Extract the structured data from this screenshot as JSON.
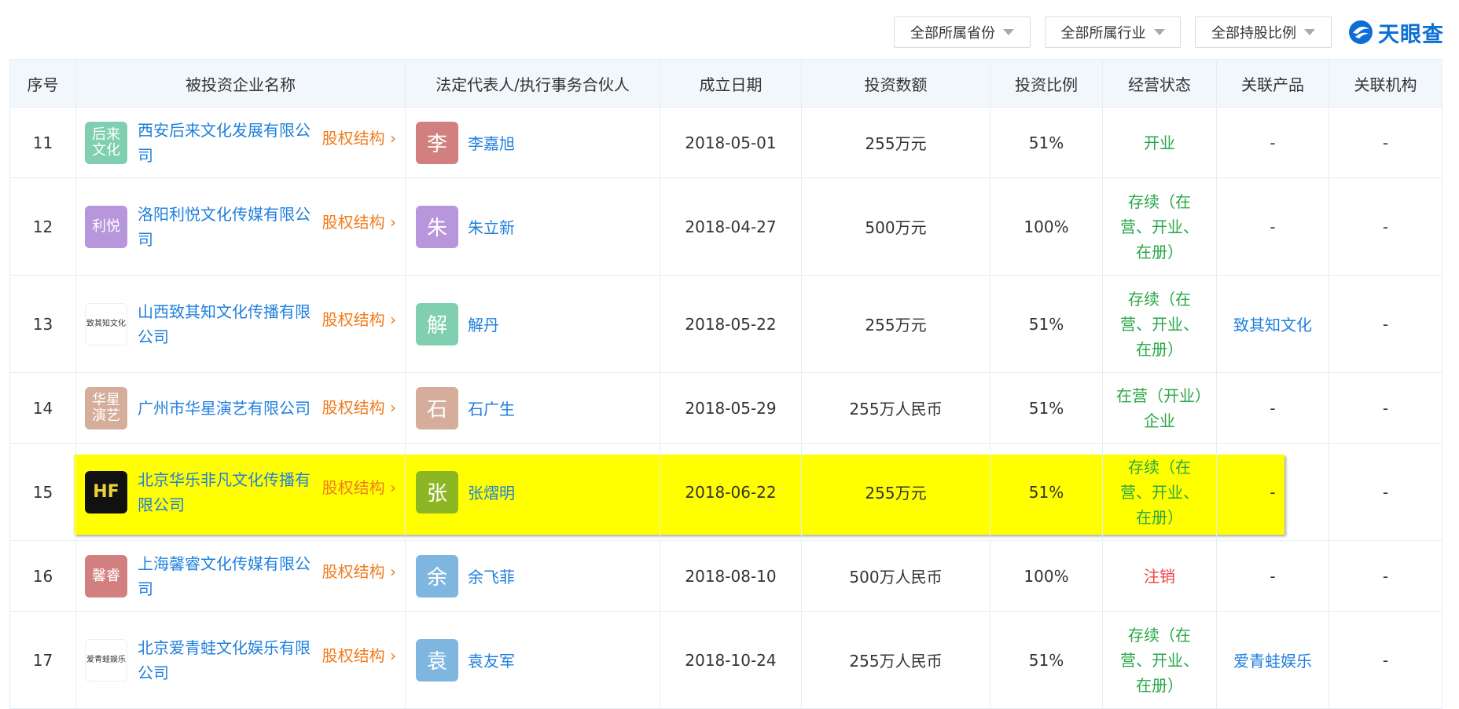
{
  "filters": [
    {
      "label": "全部所属省份",
      "icon": "caret-down-icon"
    },
    {
      "label": "全部所属行业",
      "icon": "caret-down-icon"
    },
    {
      "label": "全部持股比例",
      "icon": "caret-down-icon"
    }
  ],
  "brand": {
    "name": "天眼查",
    "color": "#0d6fd6"
  },
  "table": {
    "headers": [
      "序号",
      "被投资企业名称",
      "法定代表人/执行事务合伙人",
      "成立日期",
      "投资数额",
      "投资比例",
      "经营状态",
      "关联产品",
      "关联机构"
    ],
    "equity_label": "股权结构",
    "rows": [
      {
        "seq": "11",
        "logo_text": "后来\n文化",
        "logo_color": "#7fcfb0",
        "company": "西安后来文化发展有限公司",
        "avatar": "李",
        "avatar_color": "#d27f7f",
        "person": "李嘉旭",
        "date": "2018-05-01",
        "amount": "255万元",
        "ratio": "51%",
        "status": "开业",
        "status_color": "green",
        "product": "-",
        "org": "-"
      },
      {
        "seq": "12",
        "logo_text": "利悦",
        "logo_color": "#b796dc",
        "company": "洛阳利悦文化传媒有限公司",
        "avatar": "朱",
        "avatar_color": "#b796dc",
        "person": "朱立新",
        "date": "2018-04-27",
        "amount": "500万元",
        "ratio": "100%",
        "status": "存续（在营、开业、在册）",
        "status_color": "green",
        "product": "-",
        "org": "-"
      },
      {
        "seq": "13",
        "logo_text": "致其知文化",
        "logo_color": "#ffffff",
        "company": "山西致其知文化传播有限公司",
        "avatar": "解",
        "avatar_color": "#7fcfb0",
        "person": "解丹",
        "date": "2018-05-22",
        "amount": "255万元",
        "ratio": "51%",
        "status": "存续（在营、开业、在册）",
        "status_color": "green",
        "product": "致其知文化",
        "org": "-"
      },
      {
        "seq": "14",
        "logo_text": "华星\n演艺",
        "logo_color": "#d4ad9b",
        "company": "广州市华星演艺有限公司",
        "avatar": "石",
        "avatar_color": "#d4ad9b",
        "person": "石广生",
        "date": "2018-05-29",
        "amount": "255万人民币",
        "ratio": "51%",
        "status": "在营（开业）企业",
        "status_color": "green",
        "product": "-",
        "org": "-"
      },
      {
        "seq": "15",
        "logo_text": "HF",
        "logo_color": "#111111",
        "company": "北京华乐非凡文化传播有限公司",
        "avatar": "张",
        "avatar_color": "#8db624",
        "person": "张熠明",
        "date": "2018-06-22",
        "amount": "255万元",
        "ratio": "51%",
        "status": "存续（在营、开业、在册）",
        "status_color": "green",
        "product": "-",
        "org": "-"
      },
      {
        "seq": "16",
        "logo_text": "馨睿",
        "logo_color": "#d27f7f",
        "company": "上海馨睿文化传媒有限公司",
        "avatar": "余",
        "avatar_color": "#7fb6e0",
        "person": "余飞菲",
        "date": "2018-08-10",
        "amount": "500万人民币",
        "ratio": "100%",
        "status": "注销",
        "status_color": "red",
        "product": "-",
        "org": "-"
      },
      {
        "seq": "17",
        "logo_text": "爱青蛙娱乐",
        "logo_color": "#ffffff",
        "company": "北京爱青蛙文化娱乐有限公司",
        "avatar": "袁",
        "avatar_color": "#7fb6e0",
        "person": "袁友军",
        "date": "2018-10-24",
        "amount": "255万人民币",
        "ratio": "51%",
        "status": "存续（在营、开业、在册）",
        "status_color": "green",
        "product": "爱青蛙娱乐",
        "org": "-"
      }
    ]
  },
  "highlight": {
    "row_seq": "15",
    "color": "#ffff00"
  }
}
